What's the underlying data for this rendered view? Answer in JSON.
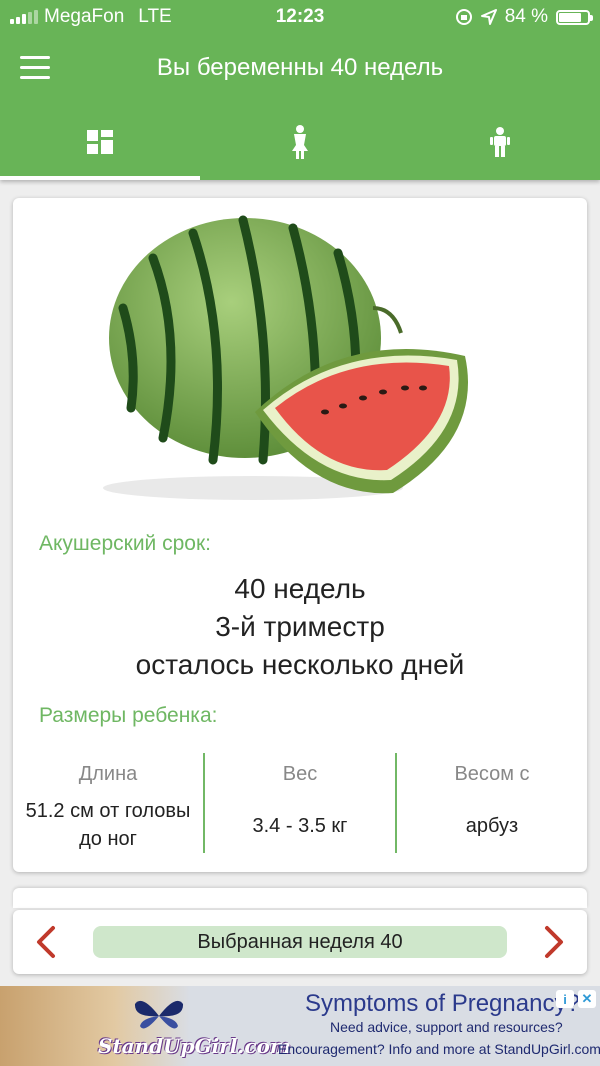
{
  "status_bar": {
    "carrier": "MegaFon",
    "network": "LTE",
    "time": "12:23",
    "battery_text": "84 %",
    "battery_level": 0.84
  },
  "header": {
    "title": "Вы беременны 40 недель",
    "menu_icon": "hamburger-icon",
    "tabs": [
      {
        "icon": "dashboard-icon",
        "active": true
      },
      {
        "icon": "woman-icon",
        "active": false
      },
      {
        "icon": "child-icon",
        "active": false
      }
    ]
  },
  "week_card": {
    "image": "watermelon",
    "obstetric_label": "Акушерский срок:",
    "term_lines": [
      "40 недель",
      "3-й триместр",
      "осталось несколько дней"
    ],
    "baby_size_label": "Размеры ребенка:",
    "stats": [
      {
        "head": "Длина",
        "value": "51.2 см от головы до ног"
      },
      {
        "head": "Вес",
        "value": "3.4 - 3.5 кг"
      },
      {
        "head": "Весом с",
        "value": "арбуз"
      }
    ]
  },
  "week_nav": {
    "selected_label": "Выбранная неделя 40",
    "prev_icon": "chevron-left-icon",
    "next_icon": "chevron-right-icon"
  },
  "ad": {
    "headline": "Symptoms of Pregnancy?",
    "line1": "Need advice, support and resources?",
    "line2": "Encouragement?  Info and more at StandUpGirl.com",
    "brand": "StandUpGirl.com"
  },
  "colors": {
    "primary": "#68b457",
    "accent_label": "#6fb763",
    "arrow_red": "#c0392b"
  }
}
